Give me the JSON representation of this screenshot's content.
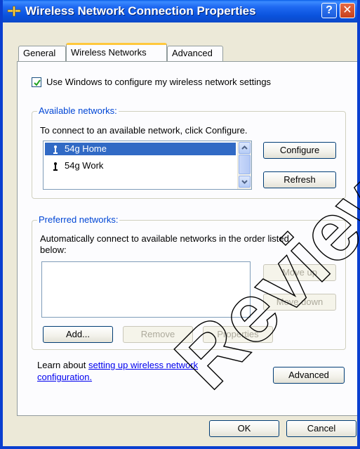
{
  "window": {
    "title": "Wireless Network Connection Properties",
    "help_glyph": "?",
    "close_glyph": "✕"
  },
  "tabs": [
    {
      "label": "General",
      "active": false
    },
    {
      "label": "Wireless Networks",
      "active": true
    },
    {
      "label": "Advanced",
      "active": false
    }
  ],
  "use_windows": {
    "label": "Use Windows to configure my wireless network settings",
    "checked": true
  },
  "available": {
    "group_label": "Available networks:",
    "instruction": "To connect to an available network, click Configure.",
    "networks": [
      {
        "name": "54g Home",
        "selected": true,
        "icon": "antenna-icon"
      },
      {
        "name": "54g Work",
        "selected": false,
        "icon": "antenna-icon"
      }
    ],
    "configure_label": "Configure",
    "refresh_label": "Refresh"
  },
  "preferred": {
    "group_label": "Preferred networks:",
    "instruction_line1": "Automatically connect to available networks in the order listed",
    "instruction_line2": "below:",
    "move_up_label": "Move up",
    "move_down_label": "Move down",
    "add_label": "Add...",
    "remove_label": "Remove",
    "properties_label": "Properties"
  },
  "learn": {
    "prefix": "Learn about ",
    "link_part1": "setting up wireless network",
    "link_part2": "configuration.",
    "advanced_label": "Advanced"
  },
  "footer": {
    "ok_label": "OK",
    "cancel_label": "Cancel"
  },
  "watermark": "Review",
  "colors": {
    "titlebar": "#0A52DD",
    "dialog_bg": "#ECE9D8",
    "selection": "#316AC5",
    "group_label": "#0046D5",
    "link": "#0000EE"
  }
}
